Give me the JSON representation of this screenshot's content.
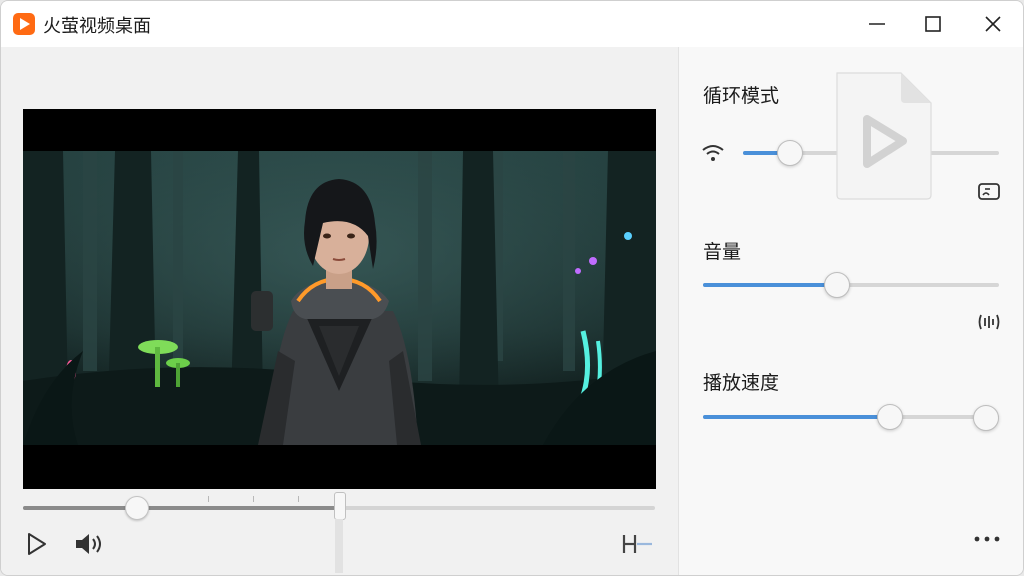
{
  "window": {
    "title": "火萤视频桌面",
    "controls": [
      "minimize-icon",
      "maximize-icon",
      "close-icon"
    ]
  },
  "player": {
    "progress": 0.18,
    "secondary_position": 0.5
  },
  "sidebar": {
    "loop_mode": {
      "title": "循环模式",
      "value": 0.18
    },
    "volume": {
      "title": "音量",
      "value": 0.45
    },
    "speed": {
      "title": "播放速度",
      "value": 0.63
    }
  },
  "icons": {
    "app": "firefly-play-logo",
    "play": "play-icon",
    "volume": "speaker-icon",
    "end": "end-marker-icon",
    "wifi": "wifi-icon",
    "file": "video-file-icon",
    "cast": "screen-cast-icon",
    "audio": "audio-wave-icon",
    "more": "more-icon"
  },
  "colors": {
    "accent": "#4a90d9",
    "logo": "#ff6a13"
  }
}
